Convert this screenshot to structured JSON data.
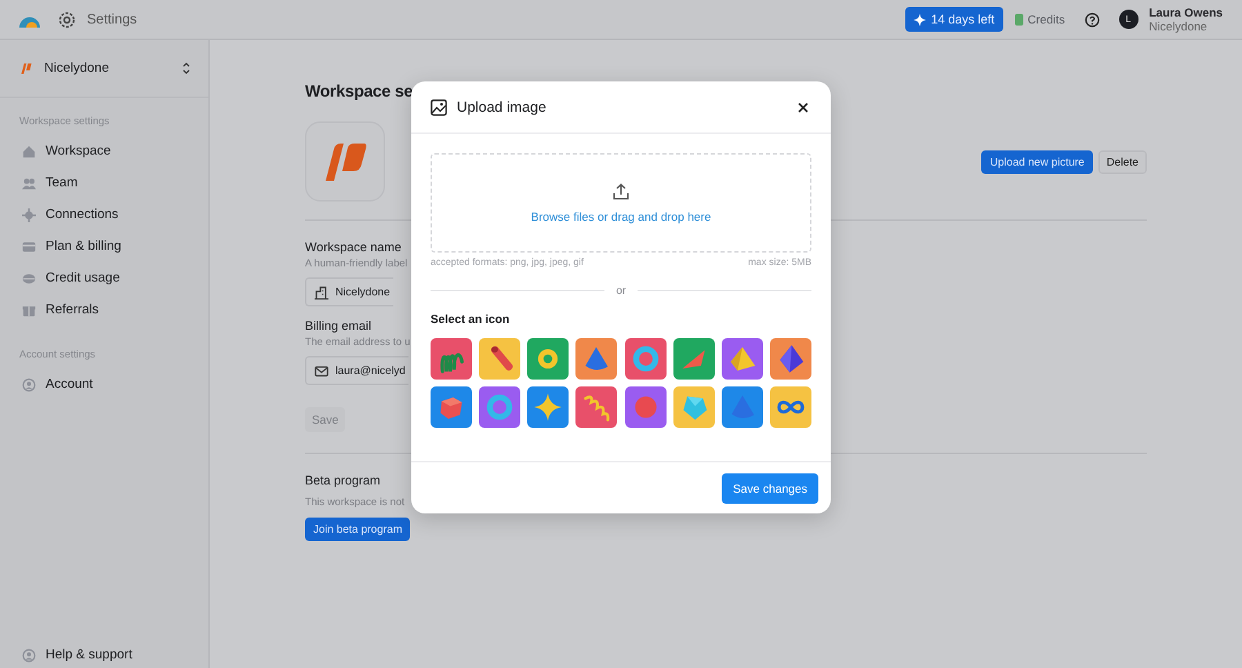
{
  "topbar": {
    "title": "Settings",
    "trial": "14 days left",
    "credits": "Credits",
    "user": {
      "initial": "L",
      "name": "Laura Owens",
      "org": "Nicelydone"
    }
  },
  "sidebar": {
    "workspace": "Nicelydone",
    "sections": [
      {
        "heading": "Workspace settings",
        "items": [
          {
            "label": "Workspace"
          },
          {
            "label": "Team"
          },
          {
            "label": "Connections"
          },
          {
            "label": "Plan & billing"
          },
          {
            "label": "Credit usage"
          },
          {
            "label": "Referrals"
          }
        ]
      },
      {
        "heading": "Account settings",
        "items": [
          {
            "label": "Account"
          }
        ]
      }
    ],
    "footer": "Help & support"
  },
  "main": {
    "title": "Workspace se",
    "upload_button": "Upload new picture",
    "delete_button": "Delete",
    "fields": [
      {
        "label": "Workspace name",
        "hint": "A human-friendly label",
        "value": "Nicelydone"
      },
      {
        "label": "Billing email",
        "hint": "The email address to u",
        "value": "laura@nicelyd"
      }
    ],
    "save_button": {
      "label": "Save",
      "disabled": true
    },
    "beta": {
      "title": "Beta program",
      "text": "This workspace is not",
      "button": "Join beta program"
    }
  },
  "modal": {
    "title": "Upload image",
    "dropzone": "Browse files or drag and drop here",
    "formats": "accepted formats: png, jpg, jpeg, gif",
    "max_size": "max size: 5MB",
    "divider": "or",
    "icons_heading": "Select an icon",
    "icons": [
      {
        "kind": "spring",
        "color": "#e8506a"
      },
      {
        "kind": "cylinder",
        "color": "#f5c242"
      },
      {
        "kind": "torus",
        "color": "#20a860"
      },
      {
        "kind": "cone",
        "color": "#f0884a"
      },
      {
        "kind": "ring",
        "color": "#e8506a"
      },
      {
        "kind": "wedge",
        "color": "#20a860"
      },
      {
        "kind": "pyramid",
        "color": "#9a5cf0"
      },
      {
        "kind": "octahedron",
        "color": "#f0884a"
      },
      {
        "kind": "cube",
        "color": "#1e88e8"
      },
      {
        "kind": "ring",
        "color": "#9a5cf0"
      },
      {
        "kind": "star",
        "color": "#1e88e8"
      },
      {
        "kind": "spiral",
        "color": "#e8506a"
      },
      {
        "kind": "sphere",
        "color": "#9a5cf0"
      },
      {
        "kind": "gem",
        "color": "#f5c242"
      },
      {
        "kind": "cone",
        "color": "#1e88e8"
      },
      {
        "kind": "infinity",
        "color": "#f5c242"
      }
    ],
    "save_button": "Save changes"
  }
}
